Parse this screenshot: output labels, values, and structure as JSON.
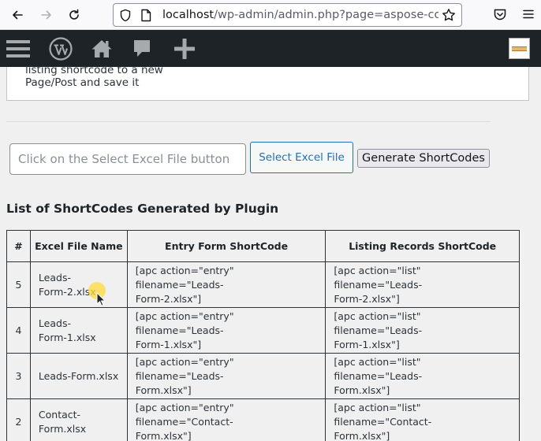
{
  "browser": {
    "url_host": "localhost",
    "url_path": "/wp-admin/admin.php?page=aspose-cont",
    "icons": [
      "back-arrow-icon",
      "forward-arrow-icon",
      "reload-icon",
      "shield-icon",
      "page-icon",
      "star-icon",
      "pocket-icon",
      "hamburger-menu-icon"
    ]
  },
  "admin_bar": {
    "icons": [
      "hamburger-menu-icon",
      "wordpress-logo-icon",
      "home-icon",
      "comment-icon",
      "plus-icon",
      "avatar"
    ]
  },
  "note": {
    "line1": "listing shortcode to a new",
    "line2": "Page/Post and save it"
  },
  "upload": {
    "placeholder": "Click on the Select Excel File button",
    "select_label": "Select Excel File",
    "generate_label": "Generate ShortCodes"
  },
  "list": {
    "heading": "List of ShortCodes Generated by Plugin",
    "headers": [
      "#",
      "Excel File Name",
      "Entry Form ShortCode",
      "Listing Records ShortCode"
    ],
    "rows": [
      {
        "num": "5",
        "file_a": "Leads-",
        "file_b": "Form-2.xlsx",
        "entry_a": "[apc action=\"entry\" filename=\"Leads-",
        "entry_b": "Form-2.xlsx\"]",
        "list_a": "[apc action=\"list\" filename=\"Leads-",
        "list_b": "Form-2.xlsx\"]"
      },
      {
        "num": "4",
        "file_a": "Leads-",
        "file_b": "Form-1.xlsx",
        "entry_a": "[apc action=\"entry\" filename=\"Leads-",
        "entry_b": "Form-1.xlsx\"]",
        "list_a": "[apc action=\"list\" filename=\"Leads-",
        "list_b": "Form-1.xlsx\"]"
      },
      {
        "num": "3",
        "file_a": "Leads-Form.xlsx",
        "file_b": "",
        "entry_a": "[apc action=\"entry\" filename=\"Leads-",
        "entry_b": "Form.xlsx\"]",
        "list_a": "[apc action=\"list\" filename=\"Leads-",
        "list_b": "Form.xlsx\"]"
      },
      {
        "num": "2",
        "file_a": "Contact-",
        "file_b": "Form.xlsx",
        "entry_a": "[apc action=\"entry\" filename=\"Contact-",
        "entry_b": "Form.xlsx\"]",
        "list_a": "[apc action=\"list\" filename=\"Contact-",
        "list_b": "Form.xlsx\"]"
      }
    ]
  },
  "colors": {
    "admin_bar_bg": "#1d2327",
    "accent": "#2271b1",
    "page_bg": "#f0f0f1"
  }
}
